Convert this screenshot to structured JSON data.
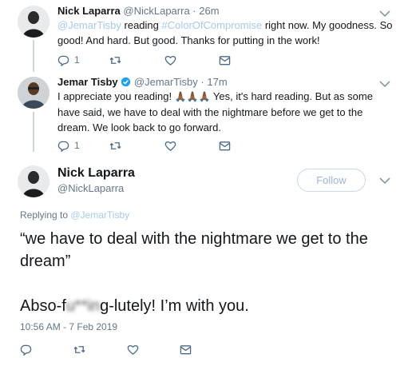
{
  "tweet1": {
    "name": "Nick Laparra",
    "handle": "@NickLaparra",
    "time": "· 26m",
    "text_mention": "@JemarTisby",
    "text_a": " reading ",
    "text_hashtag": "#ColorOfCompromise",
    "text_b": " right now. My goodness. So good! And hard. But good. Thanks for putting in the work!",
    "reply_count": "1",
    "retweet_count": "",
    "like_count": ""
  },
  "tweet2": {
    "name": "Jemar Tisby",
    "handle": "@JemarTisby",
    "time": "· 17m",
    "text_a": "I appreciate you reading! ",
    "emoji": "🙏🏾🙏🏾🙏🏾",
    "text_b": " Yes, it's hard reading. But as some have said, we have to deal with the nightmare before we get to the dream. We look back to go forward.",
    "reply_count": "1"
  },
  "main_tweet": {
    "name": "Nick Laparra",
    "handle": "@NickLaparra",
    "follow_label": "Follow",
    "replying_prefix": "Replying to ",
    "replying_handle": "@JemarTisby",
    "quote": "“we have to deal with the nightmare we get to the dream”",
    "line2_a": "Abso-f",
    "line2_blur": "u**in",
    "line2_b": "g-lutely! I’m with you.",
    "timestamp": "10:56 AM - 7 Feb 2019"
  },
  "colors": {
    "link": "#a8c9e8",
    "icon": "#4a6a88",
    "verified": "#1da1f2"
  },
  "icons": [
    "reply-icon",
    "retweet-icon",
    "like-icon",
    "dm-icon",
    "chevron-down-icon",
    "verified-icon"
  ]
}
